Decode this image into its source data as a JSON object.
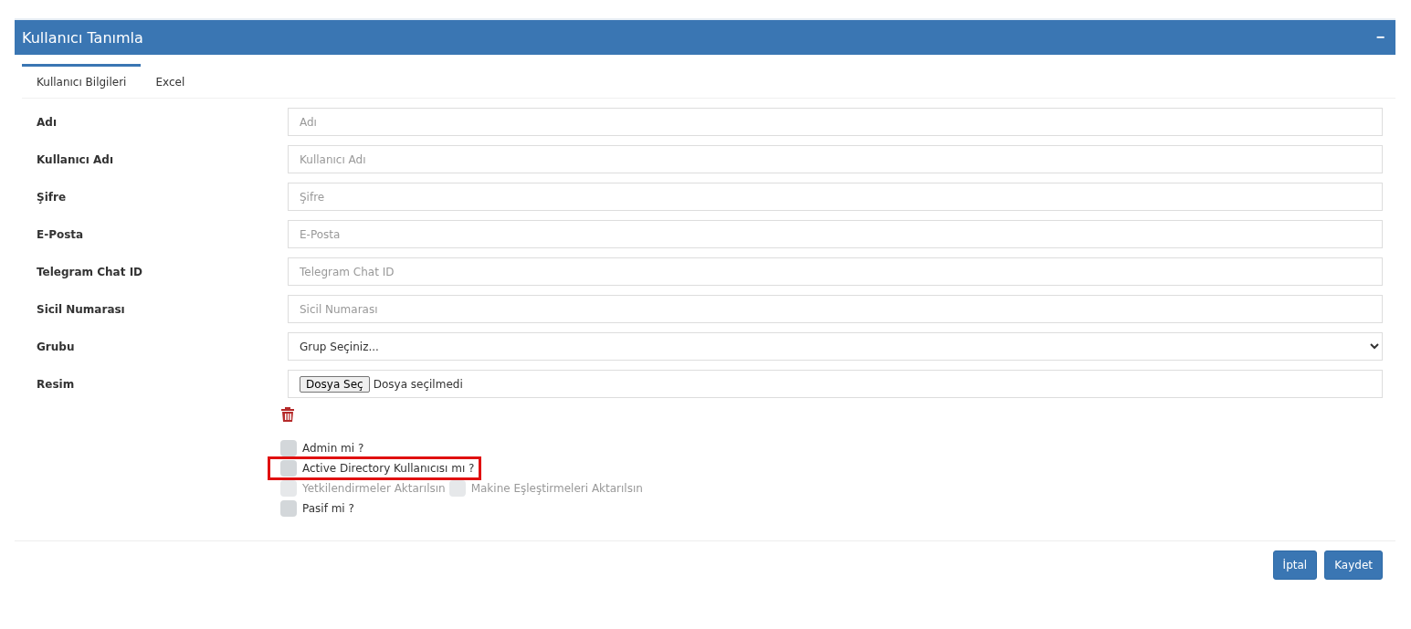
{
  "panel": {
    "title": "Kullanıcı Tanımla",
    "collapse_symbol": "−"
  },
  "tabs": [
    {
      "label": "Kullanıcı Bilgileri",
      "selected": true
    },
    {
      "label": "Excel",
      "selected": false
    }
  ],
  "fields": [
    {
      "kind": "text",
      "label": "Adı",
      "placeholder": "Adı"
    },
    {
      "kind": "text",
      "label": "Kullanıcı Adı",
      "placeholder": "Kullanıcı Adı"
    },
    {
      "kind": "text",
      "label": "Şifre",
      "placeholder": "Şifre"
    },
    {
      "kind": "text",
      "label": "E-Posta",
      "placeholder": "E-Posta"
    },
    {
      "kind": "text",
      "label": "Telegram Chat ID",
      "placeholder": "Telegram Chat ID"
    },
    {
      "kind": "text",
      "label": "Sicil Numarası",
      "placeholder": "Sicil Numarası"
    },
    {
      "kind": "select",
      "label": "Grubu",
      "value": "Grup Seçiniz..."
    },
    {
      "kind": "file",
      "label": "Resim",
      "button": "Dosya Seç",
      "value": "Dosya seçilmedi"
    }
  ],
  "checkbox_rows": [
    [
      {
        "label": "Admin mi ?",
        "checked": false,
        "disabled": false,
        "highlighted": false
      }
    ],
    [
      {
        "label": "Active Directory Kullanıcısı mı ?",
        "checked": false,
        "disabled": false,
        "highlighted": true
      }
    ],
    [
      {
        "label": "Yetkilendirmeler Aktarılsın",
        "checked": false,
        "disabled": true,
        "highlighted": false
      },
      {
        "label": "Makine Eşleştirmeleri Aktarılsın",
        "checked": false,
        "disabled": true,
        "highlighted": false
      }
    ],
    [
      {
        "label": "Pasif mi ?",
        "checked": false,
        "disabled": false,
        "highlighted": false
      }
    ]
  ],
  "buttons": [
    "İptal",
    "Kaydet"
  ]
}
